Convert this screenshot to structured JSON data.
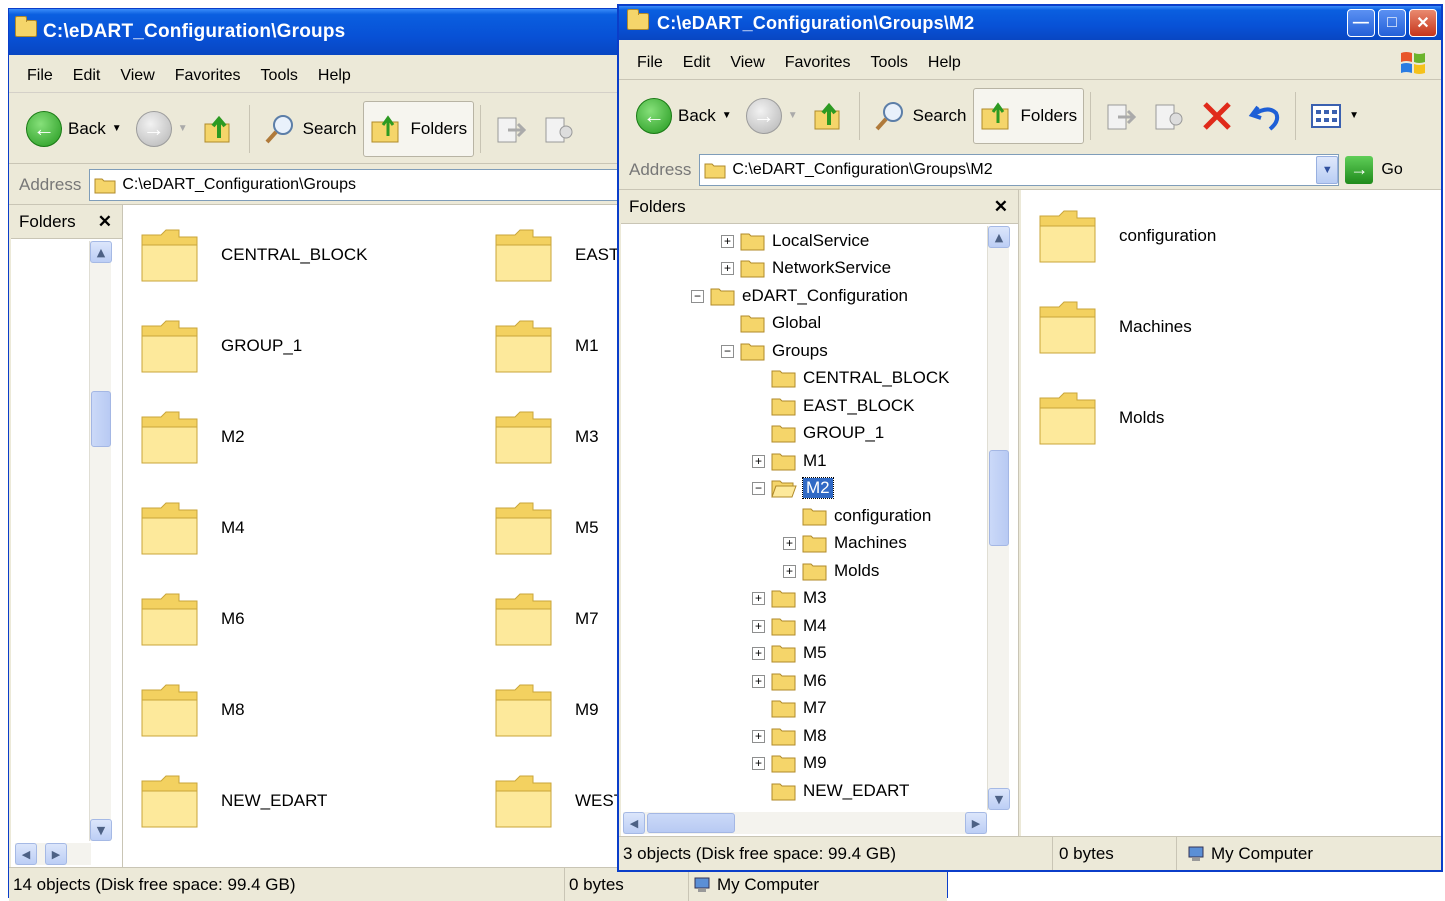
{
  "window1": {
    "title": "C:\\eDART_Configuration\\Groups",
    "menu": [
      "File",
      "Edit",
      "View",
      "Favorites",
      "Tools",
      "Help"
    ],
    "toolbar": {
      "back": "Back",
      "search": "Search",
      "folders": "Folders"
    },
    "address_label": "Address",
    "address_value": "C:\\eDART_Configuration\\Groups",
    "folders_pane_title": "Folders",
    "items_col1": [
      "CENTRAL_BLOCK",
      "GROUP_1",
      "M2",
      "M4",
      "M6",
      "M8",
      "NEW_EDART"
    ],
    "items_col2": [
      "EAST_",
      "M1",
      "M3",
      "M5",
      "M7",
      "M9",
      "WEST"
    ],
    "status": {
      "objects": "14 objects (Disk free space: 99.4 GB)",
      "size": "0 bytes",
      "zone": "My Computer"
    }
  },
  "window2": {
    "title": "C:\\eDART_Configuration\\Groups\\M2",
    "menu": [
      "File",
      "Edit",
      "View",
      "Favorites",
      "Tools",
      "Help"
    ],
    "toolbar": {
      "back": "Back",
      "search": "Search",
      "folders": "Folders"
    },
    "address_label": "Address",
    "address_value": "C:\\eDART_Configuration\\Groups\\M2",
    "go_label": "Go",
    "folders_pane_title": "Folders",
    "tree": [
      {
        "label": "LocalService",
        "level": 1,
        "expander": "+"
      },
      {
        "label": "NetworkService",
        "level": 1,
        "expander": "+"
      },
      {
        "label": "eDART_Configuration",
        "level": 0,
        "expander": "-"
      },
      {
        "label": "Global",
        "level": 1,
        "expander": ""
      },
      {
        "label": "Groups",
        "level": 1,
        "expander": "-"
      },
      {
        "label": "CENTRAL_BLOCK",
        "level": 2,
        "expander": ""
      },
      {
        "label": "EAST_BLOCK",
        "level": 2,
        "expander": ""
      },
      {
        "label": "GROUP_1",
        "level": 2,
        "expander": ""
      },
      {
        "label": "M1",
        "level": 2,
        "expander": "+"
      },
      {
        "label": "M2",
        "level": 2,
        "expander": "-",
        "selected": true
      },
      {
        "label": "configuration",
        "level": 3,
        "expander": ""
      },
      {
        "label": "Machines",
        "level": 3,
        "expander": "+"
      },
      {
        "label": "Molds",
        "level": 3,
        "expander": "+"
      },
      {
        "label": "M3",
        "level": 2,
        "expander": "+"
      },
      {
        "label": "M4",
        "level": 2,
        "expander": "+"
      },
      {
        "label": "M5",
        "level": 2,
        "expander": "+"
      },
      {
        "label": "M6",
        "level": 2,
        "expander": "+"
      },
      {
        "label": "M7",
        "level": 2,
        "expander": ""
      },
      {
        "label": "M8",
        "level": 2,
        "expander": "+"
      },
      {
        "label": "M9",
        "level": 2,
        "expander": "+"
      },
      {
        "label": "NEW_EDART",
        "level": 2,
        "expander": ""
      }
    ],
    "items": [
      "configuration",
      "Machines",
      "Molds"
    ],
    "status": {
      "objects": "3 objects (Disk free space: 99.4 GB)",
      "size": "0 bytes",
      "zone": "My Computer"
    }
  }
}
